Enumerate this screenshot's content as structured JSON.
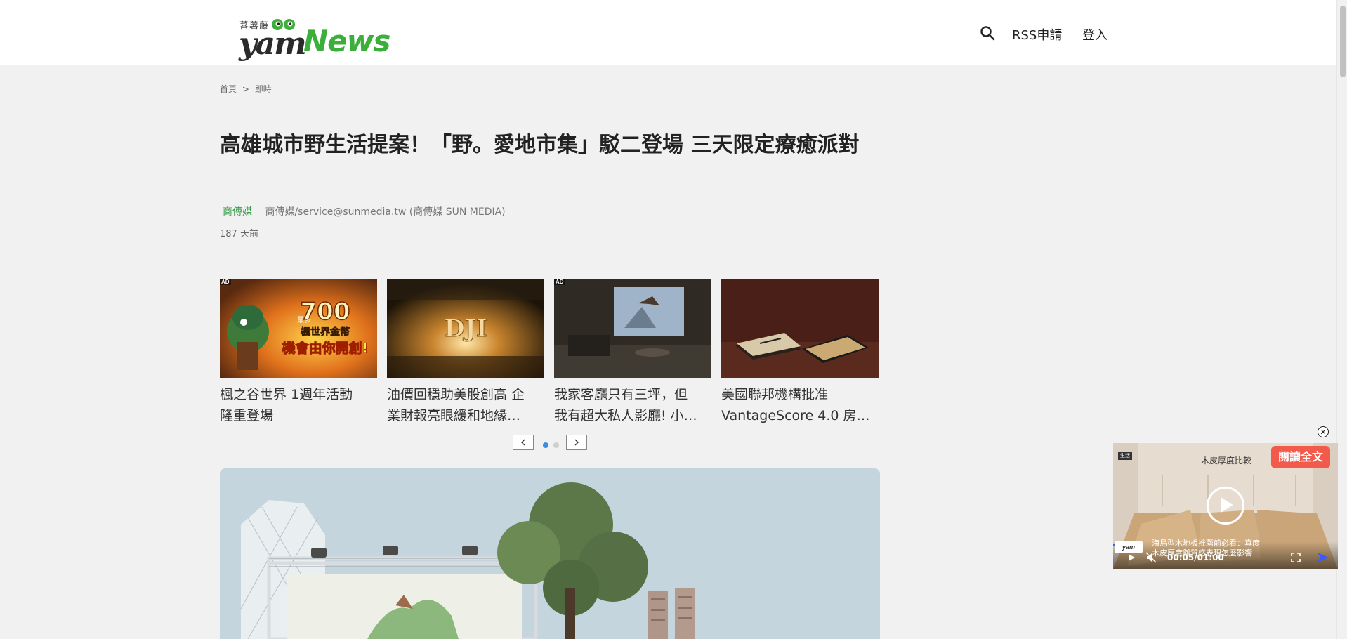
{
  "header": {
    "logo_small": "蕃薯藤",
    "logo_yam": "yam",
    "logo_news": "News",
    "nav_rss": "RSS申請",
    "nav_login": "登入"
  },
  "breadcrumb": {
    "home": "首頁",
    "sep": ">",
    "current": "即時"
  },
  "article": {
    "title": "高雄城市野生活提案！「野。愛地市集」駁二登場 三天限定療癒派對",
    "category": "商傳媒",
    "author": "商傳媒/service@sunmedia.tw (商傳媒 SUN MEDIA)",
    "time": "187 天前"
  },
  "cards": [
    {
      "ad": "AD",
      "title_l1": "楓之谷世界 1週年活動",
      "title_l2": "隆重登場"
    },
    {
      "ad": "",
      "title_l1": "油價回穩助美股創高 企",
      "title_l2": "業財報亮眼緩和地緣…"
    },
    {
      "ad": "AD",
      "title_l1": "我家客廳只有三坪，但",
      "title_l2": "我有超大私人影廳! 小…"
    },
    {
      "ad": "",
      "title_l1": "美國聯邦機構批准",
      "title_l2": "VantageScore 4.0 房…"
    }
  ],
  "card_overlays": {
    "maple_big": "700",
    "maple_pre": "最多",
    "maple_l1": "楓世界金幣",
    "maple_l2": "機會由你開創!",
    "dji": "DJI"
  },
  "video": {
    "read_full": "閱讀全文",
    "title": "木皮厚度比較",
    "badge": "生活",
    "yam": "yam",
    "caption_l1": "海島型木地板推薦前必看：真度",
    "caption_l2": "木皮厚度與質感表現怎麼影響",
    "time": "00:05/01:00",
    "close": "✕"
  },
  "colors": {
    "brand_green": "#3cae3a",
    "read_full_bg": "#f25a4b",
    "category_green": "#3a9a4a",
    "active_dot": "#3a8de0"
  }
}
